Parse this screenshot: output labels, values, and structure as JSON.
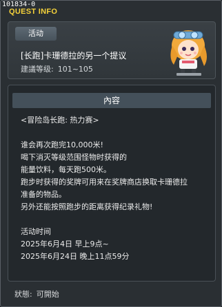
{
  "window": {
    "quest_id": "101834-0",
    "title": "QUEST INFO"
  },
  "header": {
    "badge": "活动",
    "quest_name": "[长跑]卡珊德拉的另一个提议",
    "level_label": "建議等级:",
    "level_value": "101~105",
    "npc_icon": "npc-portrait-icon"
  },
  "content": {
    "section_title": "內容",
    "lines": [
      "<冒险岛长跑: 热力赛>",
      "",
      "谁会再次跑完10,000米!",
      "喝下消灭等级范围怪物时获得的",
      "能量饮料，每天跑500米。",
      "跑步时获得的奖牌可用来在奖牌商店换取卡珊德拉",
      "准备的物品。",
      "另外还能按照跑步的距离获得纪录礼物!",
      "",
      "活动时间",
      "2025年6月4日 早上9点~",
      "2025年6月24日 晚上11点59分"
    ]
  },
  "footer": {
    "status_label": "狀態:",
    "status_value": "可開始"
  },
  "colors": {
    "title": "#f5d23a",
    "window_bg": "#2a2f33",
    "panel_bg": "#23282c",
    "section_header_bg": "#44505a"
  }
}
